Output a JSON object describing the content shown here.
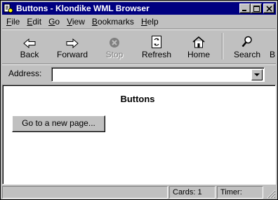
{
  "window": {
    "title": "Buttons - Klondike WML Browser",
    "title_bar_color": "#000080"
  },
  "menu": {
    "items": [
      {
        "label": "File",
        "mnemonic": "F",
        "rest": "ile"
      },
      {
        "label": "Edit",
        "mnemonic": "E",
        "rest": "dit"
      },
      {
        "label": "Go",
        "mnemonic": "G",
        "rest": "o"
      },
      {
        "label": "View",
        "mnemonic": "V",
        "rest": "iew"
      },
      {
        "label": "Bookmarks",
        "mnemonic": "B",
        "rest": "ookmarks"
      },
      {
        "label": "Help",
        "mnemonic": "H",
        "rest": "elp"
      }
    ]
  },
  "toolbar": {
    "back": {
      "label": "Back",
      "icon": "arrow-left-icon"
    },
    "forward": {
      "label": "Forward",
      "icon": "arrow-right-icon"
    },
    "stop": {
      "label": "Stop",
      "icon": "stop-icon",
      "enabled": false
    },
    "refresh": {
      "label": "Refresh",
      "icon": "refresh-icon"
    },
    "home": {
      "label": "Home",
      "icon": "home-icon"
    },
    "search": {
      "label": "Search",
      "icon": "search-icon"
    },
    "bookmarks_partial": {
      "label": "B"
    }
  },
  "address": {
    "label": "Address:",
    "value": ""
  },
  "content": {
    "title": "Buttons",
    "button_label": "Go to a new page..."
  },
  "status": {
    "main": "",
    "cards": "Cards: 1",
    "timer": "Timer:"
  }
}
